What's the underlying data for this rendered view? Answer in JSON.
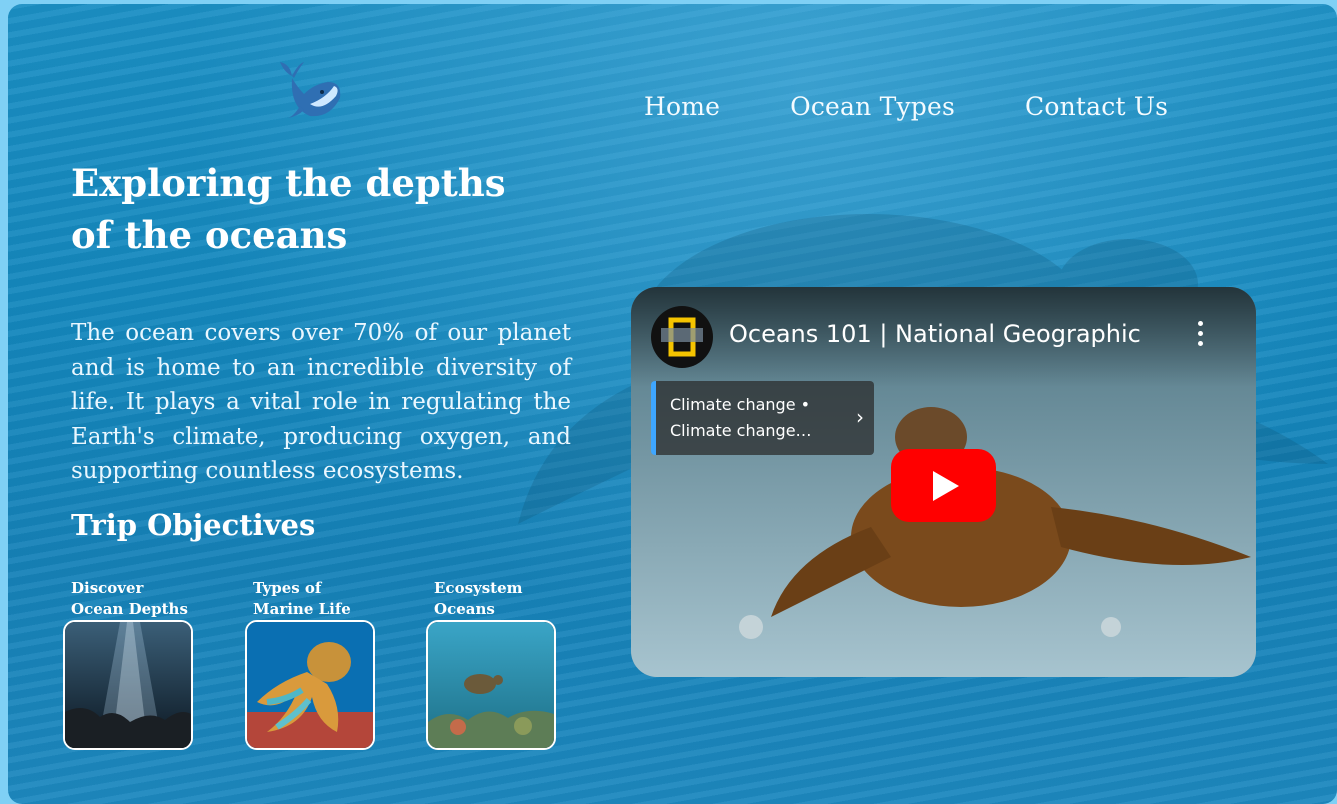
{
  "nav": {
    "home": "Home",
    "ocean_types": "Ocean Types",
    "contact": "Contact Us"
  },
  "hero": {
    "title": "Exploring the depths of the oceans",
    "intro": "The ocean covers over 70% of our planet and is home to an incredible diversity of life. It plays a vital role in regulating the Earth's climate, producing oxygen, and supporting countless ecosystems."
  },
  "objectives": {
    "heading": "Trip Objectives",
    "items": [
      {
        "label": "Discover Ocean Depths"
      },
      {
        "label": "Types of Marine Life"
      },
      {
        "label": "Ecosystem Oceans"
      }
    ]
  },
  "video": {
    "title": "Oceans 101 | National Geographic",
    "playlist_line1": "Climate change •",
    "playlist_line2": "Climate change…"
  },
  "icons": {
    "logo": "whale-icon",
    "play": "play-icon",
    "more": "more-vert-icon",
    "chevron": "chevron-right-icon"
  },
  "colors": {
    "accent": "#1487bd",
    "youtube_red": "#ff0000",
    "playlist_bar": "#3ea6ff"
  }
}
